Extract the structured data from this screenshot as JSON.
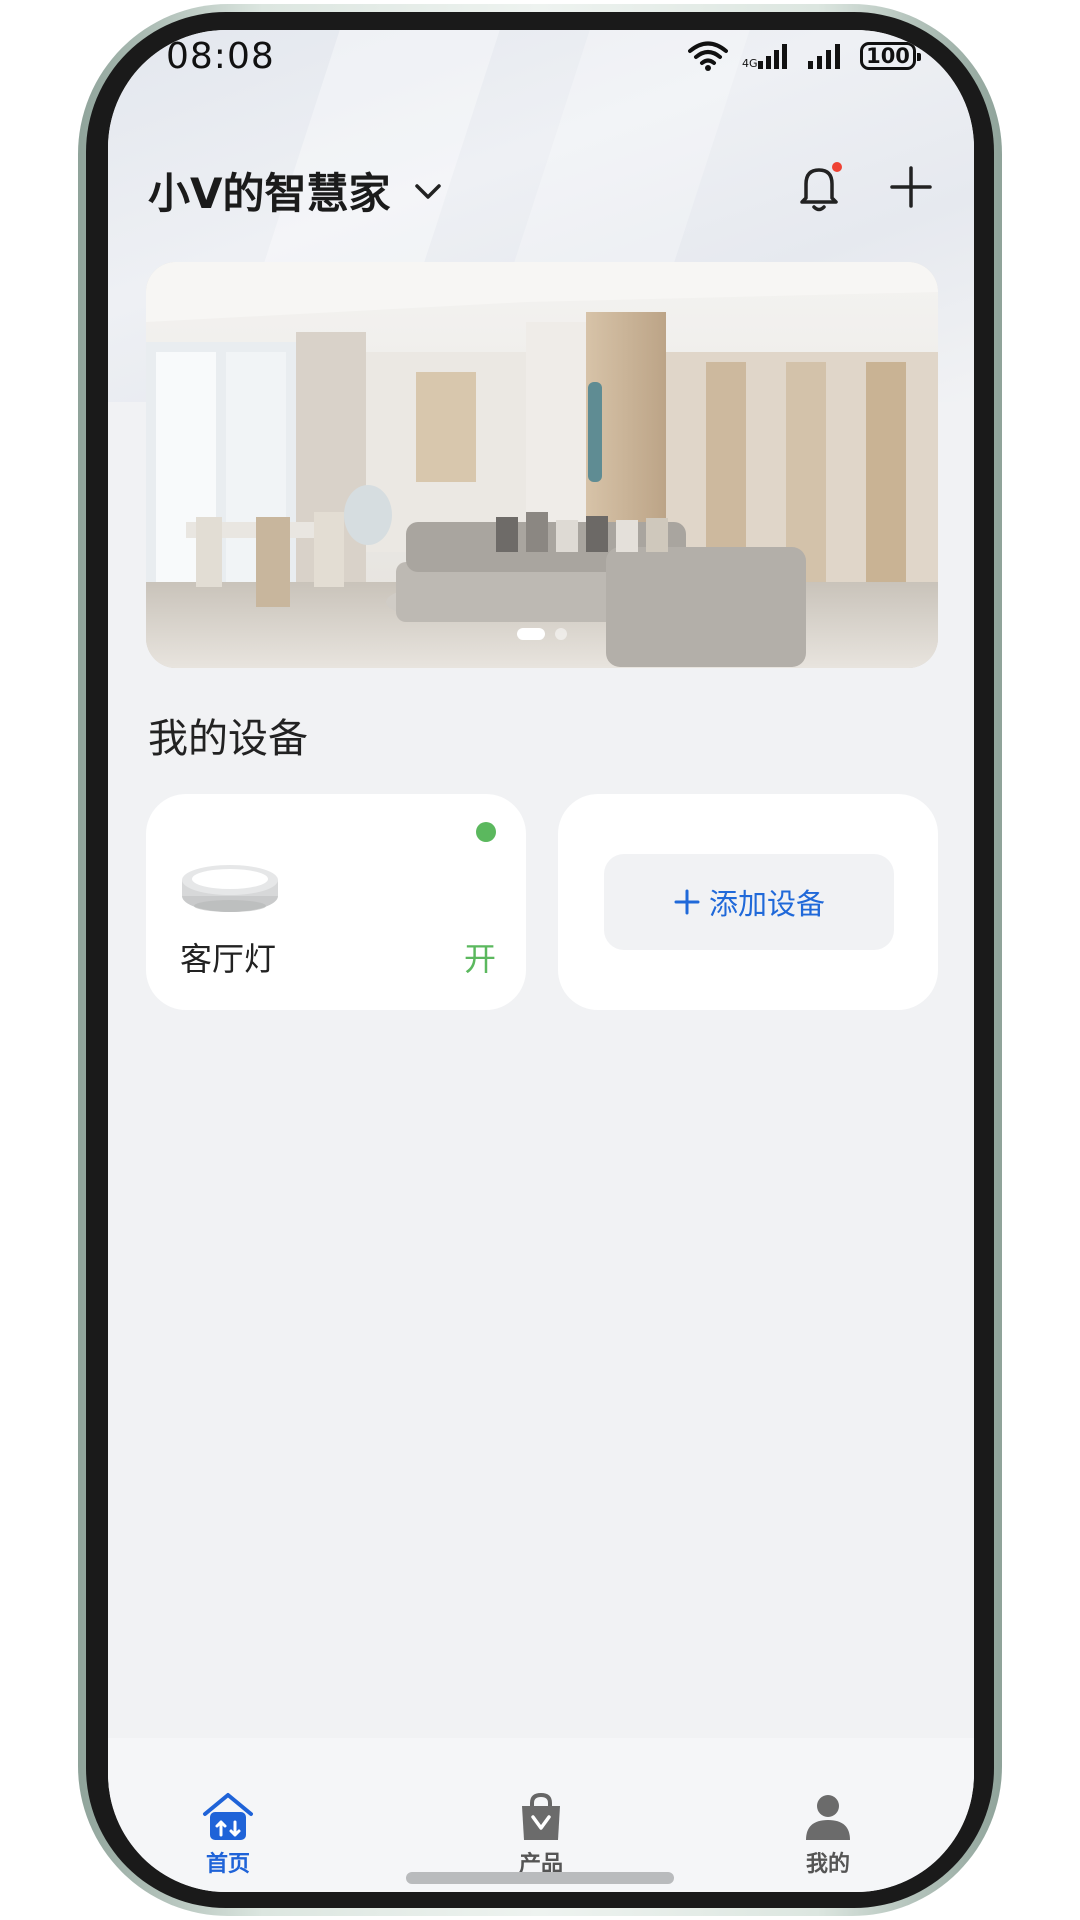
{
  "status_bar": {
    "time": "08:08",
    "battery": "100",
    "icons": [
      "wifi-icon",
      "signal-icon",
      "signal-icon",
      "battery-icon"
    ]
  },
  "header": {
    "home_name": "小V的智慧家",
    "dropdown_icon": "chevron-down-icon",
    "notification_icon": "bell-icon",
    "has_unread": true,
    "add_icon": "plus-icon"
  },
  "banner": {
    "image": "living-room-photo",
    "page_count": 2,
    "active_page": 1
  },
  "devices": {
    "section_title": "我的设备",
    "items": [
      {
        "name": "客厅灯",
        "state": "开",
        "online": true,
        "icon": "ceiling-light-icon"
      }
    ],
    "add_label": "添加设备",
    "add_icon": "plus-icon"
  },
  "tabbar": {
    "tabs": [
      {
        "label": "首页",
        "icon": "home-icon",
        "active": true
      },
      {
        "label": "产品",
        "icon": "shopping-bag-icon",
        "active": false
      },
      {
        "label": "我的",
        "icon": "person-icon",
        "active": false
      }
    ]
  },
  "colors": {
    "accent": "#1f63d8",
    "online": "#5bb85e",
    "badge": "#ef4234",
    "background": "#f1f2f4"
  }
}
